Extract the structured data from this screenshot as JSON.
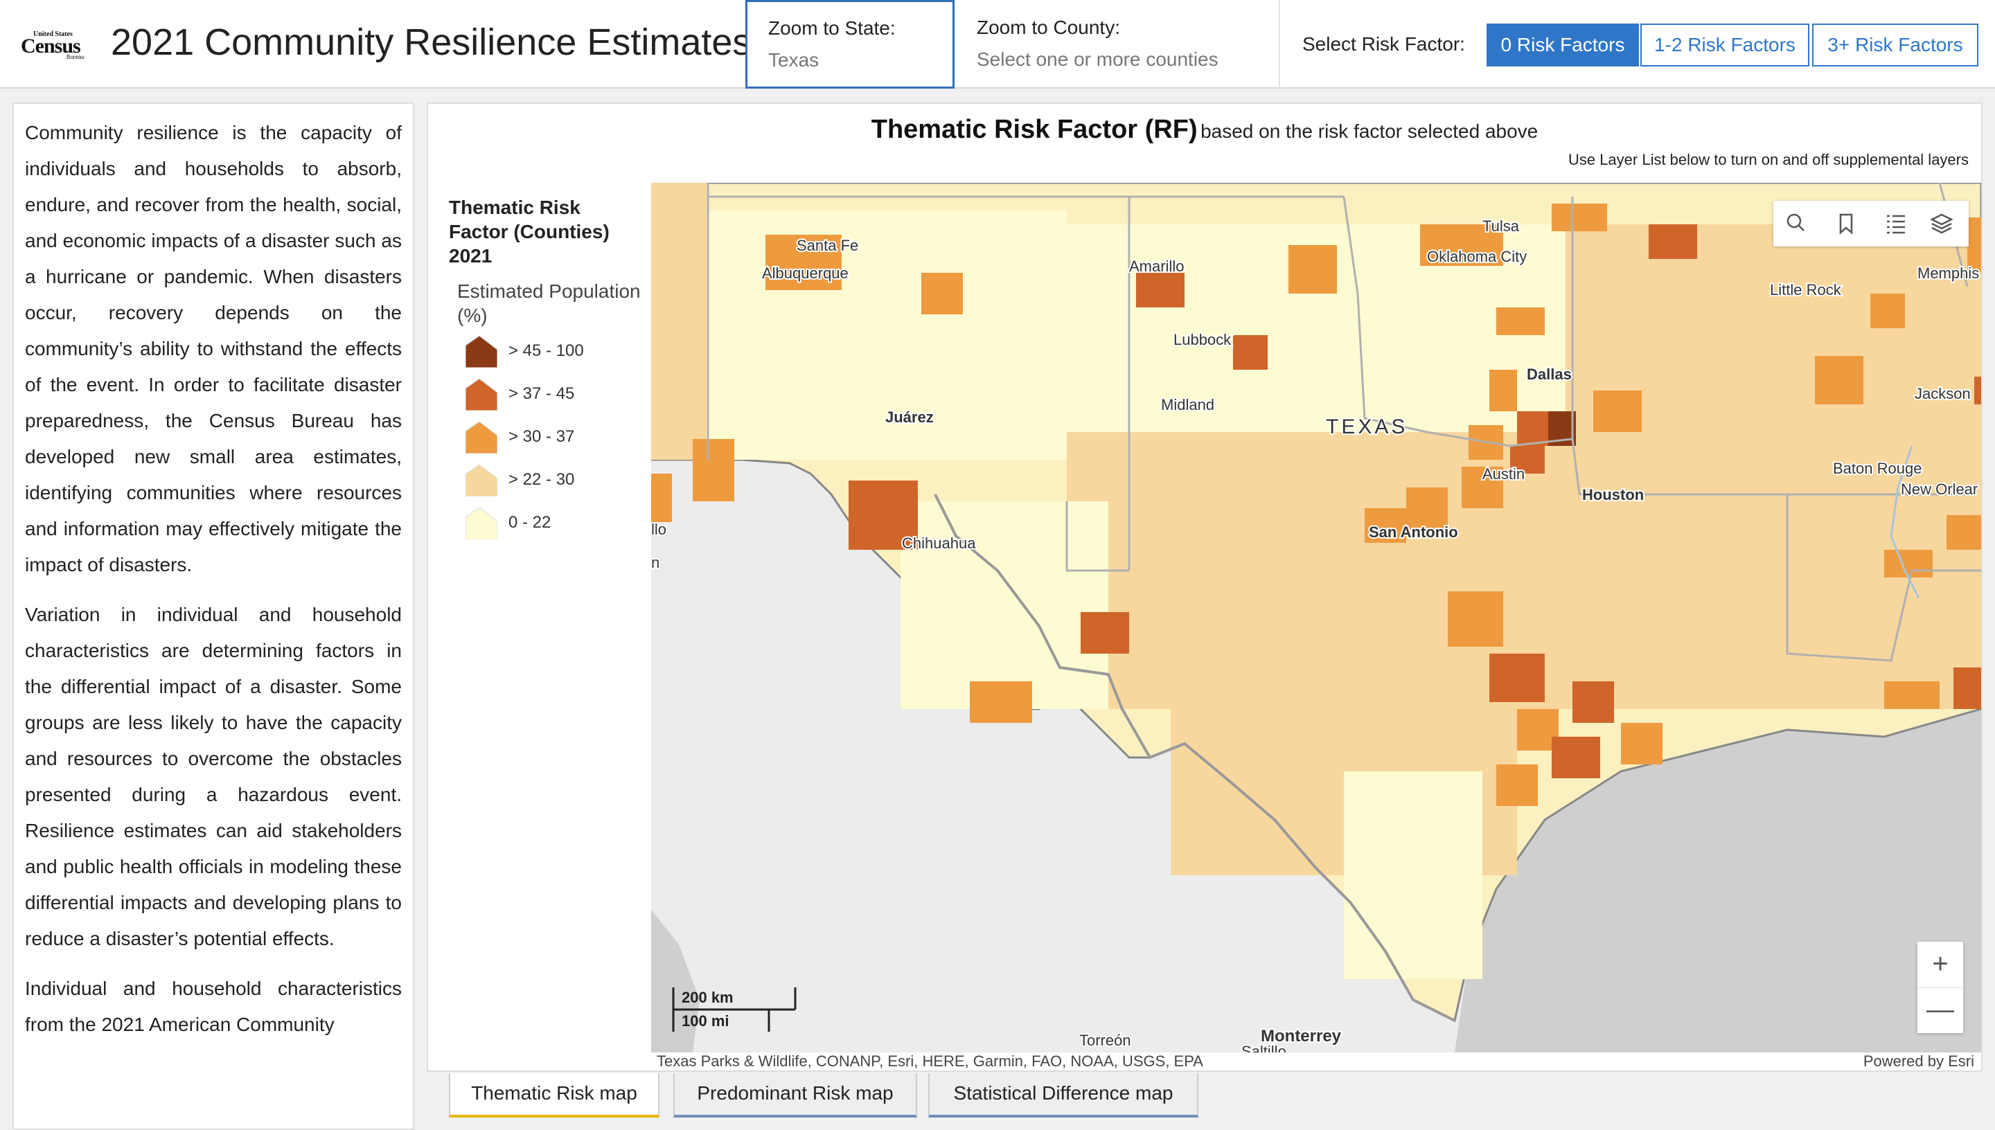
{
  "header": {
    "logo": {
      "line1": "United States",
      "line2": "Census",
      "line3": "Bureau"
    },
    "title": "2021 Community Resilience Estimates",
    "zoom_state": {
      "label": "Zoom to State:",
      "value": "Texas"
    },
    "zoom_county": {
      "label": "Zoom to County:",
      "placeholder": "Select one or more counties"
    },
    "risk_label": "Select Risk Factor:",
    "risk_buttons": [
      {
        "label": "0 Risk Factors",
        "active": true
      },
      {
        "label": "1-2 Risk Factors",
        "active": false
      },
      {
        "label": "3+ Risk Factors",
        "active": false
      }
    ]
  },
  "intro": {
    "paragraphs": [
      "Community resilience is the capacity of individuals and households to absorb, endure, and recover from the health, social, and economic impacts of a disaster such as a hurricane or pandemic.  When disasters occur, recovery depends on the community’s ability to withstand the effects of the event. In order to facilitate disaster preparedness, the Census Bureau has developed new small area estimates, identifying communities where resources and information may effectively mitigate the impact of disasters.",
      "Variation in individual and household characteristics are determining factors in the differential impact of a disaster. Some groups are less likely to have the capacity and resources to overcome the obstacles presented during a hazardous event.  Resilience estimates can aid stakeholders and public health officials in modeling these differential impacts and developing plans to reduce a disaster’s potential effects.",
      "Individual and household characteristics from the 2021 American Community"
    ]
  },
  "map": {
    "title_bold": "Thematic Risk Factor (RF)",
    "title_rest": "based on the risk factor selected above",
    "hint": "Use Layer List below to turn on and off supplemental layers",
    "legend": {
      "title": "Thematic Risk Factor (Counties) 2021",
      "subtitle": "Estimated Population (%)",
      "classes": [
        {
          "label": "> 45 - 100",
          "color": "#8b3a16"
        },
        {
          "label": "> 37 - 45",
          "color": "#d0652a"
        },
        {
          "label": "> 30 - 37",
          "color": "#ee9a3f"
        },
        {
          "label": "> 22 - 30",
          "color": "#f8d79e"
        },
        {
          "label": "0 - 22",
          "color": "#fdfbd2"
        }
      ]
    },
    "places": {
      "santa_fe": "Santa Fe",
      "albuquerque": "Albuquerque",
      "amarillo": "Amarillo",
      "tulsa": "Tulsa",
      "oklahoma_city": "Oklahoma City",
      "memphis": "Memphis",
      "little_rock": "Little Rock",
      "lubbock": "Lubbock",
      "dallas": "Dallas",
      "jackson": "Jackson",
      "midland": "Midland",
      "juarez": "Juárez",
      "texas": "TEXAS",
      "austin": "Austin",
      "baton_rouge": "Baton Rouge",
      "houston": "Houston",
      "new_orleans": "New Orlear",
      "san_antonio": "San Antonio",
      "chihuahua": "Chihuahua",
      "illo": "llo",
      "torreon": "Torreón",
      "monterrey": "Monterrey",
      "saltillo": "Saltillo",
      "edge_n": "n"
    },
    "scale": {
      "km": "200 km",
      "mi": "100 mi"
    },
    "attribution": "Texas Parks & Wildlife, CONANP, Esri, HERE, Garmin, FAO, NOAA, USGS, EPA",
    "powered_by": "Powered by Esri",
    "tools": [
      "search-icon",
      "bookmark-icon",
      "layer-list-icon",
      "basemap-layers-icon"
    ],
    "zoom_in": "+",
    "zoom_out": "—"
  },
  "tabs": [
    {
      "label": "Thematic Risk map",
      "active": true
    },
    {
      "label": "Predominant Risk map",
      "active": false
    },
    {
      "label": "Statistical Difference map",
      "active": false
    }
  ]
}
